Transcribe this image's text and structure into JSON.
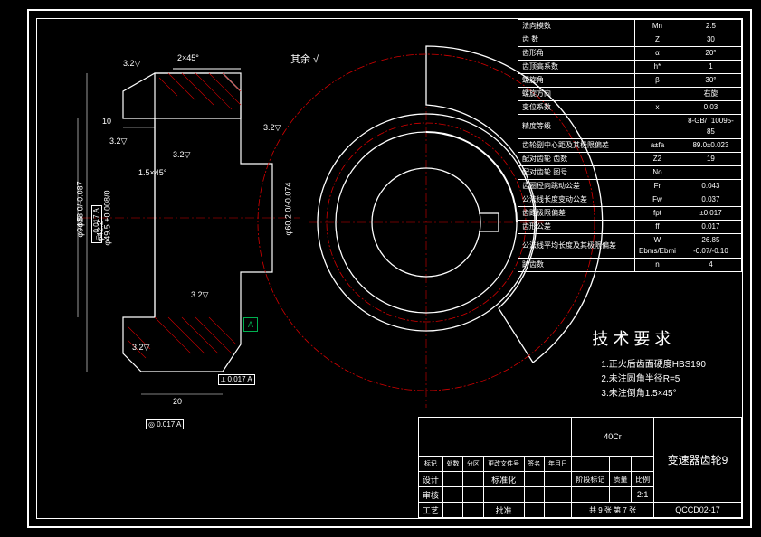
{
  "header_mark": "其余 √",
  "params": [
    [
      "法向模数",
      "Mn",
      "2.5"
    ],
    [
      "齿 数",
      "Z",
      "30"
    ],
    [
      "齿形角",
      "α",
      "20°"
    ],
    [
      "齿顶高系数",
      "h*",
      "1"
    ],
    [
      "螺旋角",
      "β",
      "30°"
    ],
    [
      "螺旋方向",
      "",
      "右旋"
    ],
    [
      "变位系数",
      "x",
      "0.03"
    ],
    [
      "精度等级",
      "",
      "8-GB/T10095-85"
    ],
    [
      "齿轮副中心距及其极限偏差",
      "a±fa",
      "89.0±0.023"
    ],
    [
      "配对齿轮 齿数",
      "Z2",
      "19"
    ],
    [
      "配对齿轮 图号",
      "No",
      ""
    ],
    [
      "齿圈径向跳动公差",
      "Fr",
      "0.043"
    ],
    [
      "公法线长度变动公差",
      "Fw",
      "0.037"
    ],
    [
      "齿距极限偏差",
      "fpt",
      "±0.017"
    ],
    [
      "齿形公差",
      "ff",
      "0.017"
    ],
    [
      "公法线平均长度及其极限偏差",
      "W Ebms/Ebmi",
      "26.85 -0.07/-0.10"
    ],
    [
      "跨齿数",
      "n",
      "4"
    ]
  ],
  "tech": {
    "title": "技 术 要 求",
    "items": [
      "1.正火后齿面硬度HBS190",
      "2.未注圆角半径R=5",
      "3.未注倒角1.5×45°"
    ]
  },
  "title_block": {
    "material": "40Cr",
    "part_name": "变速器齿轮9",
    "scale_lbl": "比例",
    "scale": "2:1",
    "weight_lbl": "质量",
    "dwg_no": "QCCD02-17",
    "sheet": "共 9 张      第 7 张",
    "row_hdrs": [
      "标记",
      "处数",
      "分区",
      "更改文件号",
      "签名",
      "年月日"
    ],
    "rows_l": [
      "设计",
      "审核",
      "工艺"
    ],
    "rows_r_lbl": [
      "标准化",
      "批准"
    ],
    "rows_r2": [
      "阶段标记",
      "质量",
      "比例"
    ]
  },
  "dims": {
    "d1": "φ88 0/-0.087",
    "d2": "φ94.5",
    "d3": "φ49.5 +0.008/0",
    "d4": "φ42.2",
    "d5": "φ60.2 0/-0.074",
    "w1": "10",
    "w2": "20",
    "ch1": "2×45°",
    "ch2": "1.5×45°",
    "surf1": "3.2",
    "surf2": "3.2",
    "surf3": "3.2",
    "surf4": "3.2",
    "surf5": "3.2",
    "tol1": "⌓ 0.017 A",
    "tol2": "⟂ 0.017 A",
    "tol3": "◎ 0.017 A",
    "datumA": "A"
  }
}
